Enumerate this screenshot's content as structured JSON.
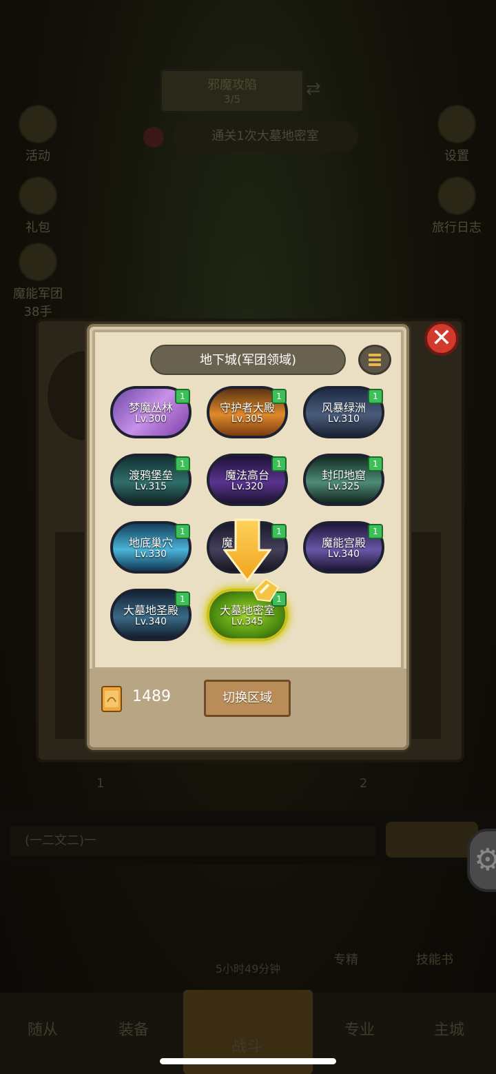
{
  "background": {
    "top_banner": {
      "line1": "邪魔攻陷",
      "line2": "3/5"
    },
    "quest": "通关1次大墓地密室",
    "left_buttons": [
      {
        "label": "活动",
        "icon": "gift-box-icon"
      },
      {
        "label": "礼包",
        "icon": "coin-bag-icon"
      },
      {
        "label": "魔能军团",
        "icon": "skull-shield-icon",
        "sub": "38手"
      }
    ],
    "right_buttons": [
      {
        "label": "设置",
        "icon": "gear-icon"
      },
      {
        "label": "旅行日志",
        "icon": "book-icon"
      }
    ],
    "chat_placeholder": "(一二文二)一",
    "timer_text": "5小时49分钟",
    "mid_labels": [
      "专精",
      "技能书"
    ],
    "slot_numbers": [
      "1",
      "2"
    ],
    "tabs": [
      "随从",
      "装备",
      "战斗",
      "专业",
      "主城"
    ]
  },
  "modal": {
    "title": "地下城(军团领域)",
    "dungeons": [
      {
        "name": "梦魔丛林",
        "level": "Lv.300",
        "badge": "1"
      },
      {
        "name": "守护者大殿",
        "level": "Lv.305",
        "badge": "1"
      },
      {
        "name": "风暴绿洲",
        "level": "Lv.310",
        "badge": "1"
      },
      {
        "name": "渡鸦堡垒",
        "level": "Lv.315",
        "badge": "1"
      },
      {
        "name": "魔法高台",
        "level": "Lv.320",
        "badge": "1"
      },
      {
        "name": "封印地窟",
        "level": "Lv.325",
        "badge": "1"
      },
      {
        "name": "地底巢穴",
        "level": "Lv.330",
        "badge": "1"
      },
      {
        "name": "魔",
        "level": "",
        "badge": "1"
      },
      {
        "name": "魔能宫殿",
        "level": "Lv.340",
        "badge": "1"
      },
      {
        "name": "大墓地圣殿",
        "level": "Lv.340",
        "badge": "1"
      },
      {
        "name": "大墓地密室",
        "level": "Lv.345",
        "badge": "1"
      }
    ],
    "selected_dungeon": "大墓地密室",
    "currency_count": "1489",
    "switch_label": "切换区域"
  },
  "colors": {
    "accent_gold": "#f0b43a",
    "badge_green": "#3fbf5a",
    "close_red": "#d23a2c"
  }
}
